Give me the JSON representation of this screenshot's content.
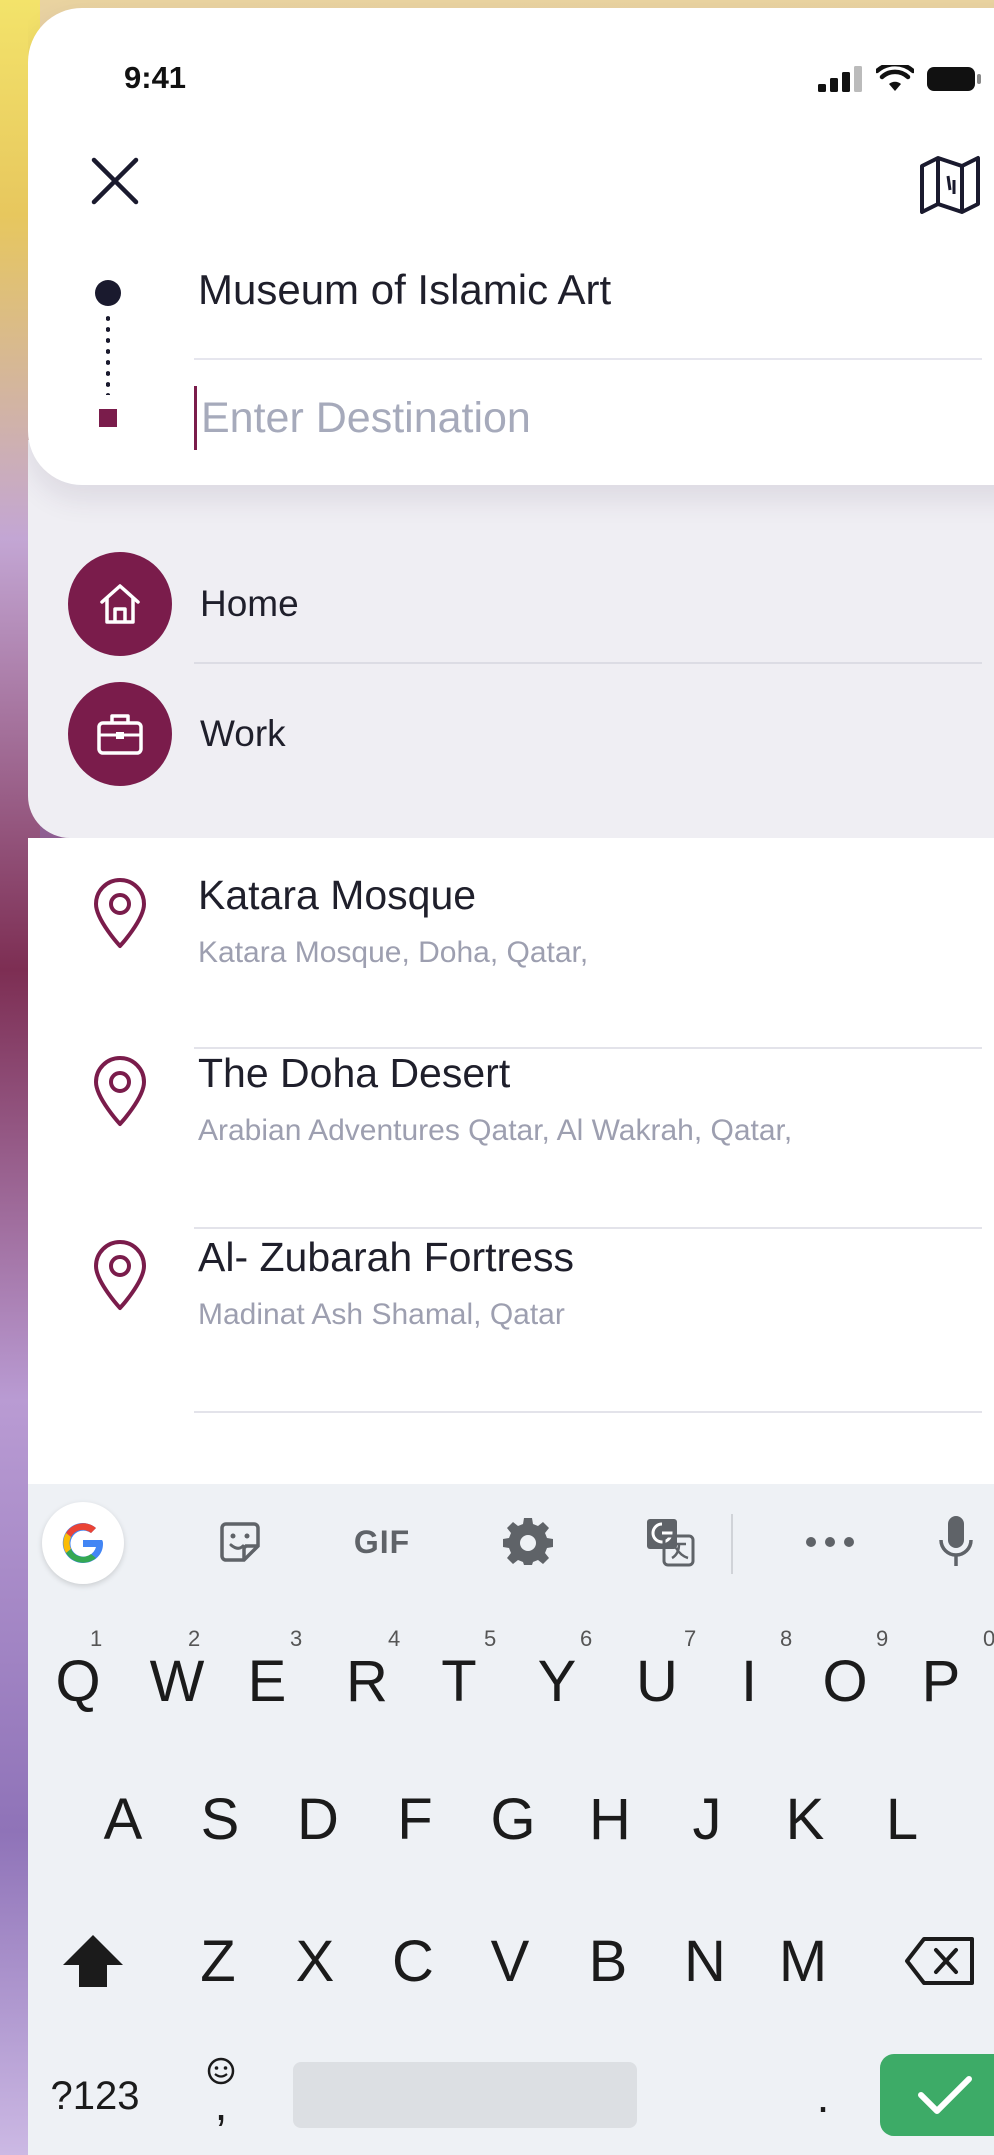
{
  "status_bar": {
    "time": "9:41"
  },
  "route": {
    "origin": "Museum of Islamic Art",
    "destination_value": "",
    "destination_placeholder": "Enter Destination"
  },
  "saved_places": [
    {
      "label": "Home",
      "icon": "home-icon"
    },
    {
      "label": "Work",
      "icon": "briefcase-icon"
    }
  ],
  "results": [
    {
      "title": "Katara Mosque",
      "subtitle": "Katara Mosque, Doha, Qatar,"
    },
    {
      "title": "The Doha Desert",
      "subtitle": "Arabian Adventures Qatar, Al Wakrah, Qatar,"
    },
    {
      "title": "Al- Zubarah Fortress",
      "subtitle": "Madinat Ash Shamal, Qatar"
    }
  ],
  "keyboard": {
    "toolbar": {
      "gif_label": "GIF"
    },
    "row1": [
      "Q",
      "W",
      "E",
      "R",
      "T",
      "Y",
      "U",
      "I",
      "O",
      "P"
    ],
    "row1_hints": [
      "1",
      "2",
      "3",
      "4",
      "5",
      "6",
      "7",
      "8",
      "9",
      "0"
    ],
    "row2": [
      "A",
      "S",
      "D",
      "F",
      "G",
      "H",
      "J",
      "K",
      "L"
    ],
    "row3": [
      "Z",
      "X",
      "C",
      "V",
      "B",
      "N",
      "M"
    ],
    "symbols_label": "?123",
    "comma_label": ",",
    "period_label": "."
  },
  "colors": {
    "brand": "#7a1c4b",
    "enter": "#3dab67"
  }
}
